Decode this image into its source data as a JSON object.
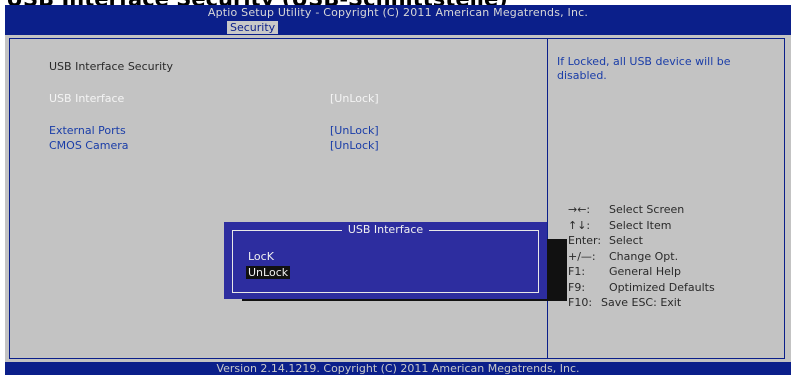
{
  "document": {
    "heading": "USB Interface Security (USB-Schnittstelle)"
  },
  "header": {
    "title": "Aptio Setup Utility - Copyright (C) 2011 American Megatrends, Inc.",
    "active_tab": "Security"
  },
  "section_title": "USB Interface Security",
  "settings": [
    {
      "label": "USB Interface",
      "value": "[UnLock]"
    },
    {
      "label": "External Ports",
      "value": "[UnLock]"
    },
    {
      "label": "CMOS Camera",
      "value": "[UnLock]"
    }
  ],
  "help": "If Locked, all USB device will be disabled.",
  "keys": [
    {
      "key": "→←:",
      "desc": "Select Screen"
    },
    {
      "key": "↑↓:",
      "desc": "Select Item"
    },
    {
      "key": "Enter:",
      "desc": "Select"
    },
    {
      "key": "+/—:",
      "desc": "Change Opt."
    },
    {
      "key": "F1:",
      "desc": "General Help"
    },
    {
      "key": "F9:",
      "desc": "Optimized Defaults"
    },
    {
      "key": "F10:",
      "desc": "Save   ESC: Exit"
    }
  ],
  "popup": {
    "title": "USB Interface",
    "options": [
      "LocK",
      "UnLock"
    ],
    "selected": "UnLock"
  },
  "footer": {
    "version": "Version 2.14.1219. Copyright (C) 2011 American Megatrends, Inc."
  },
  "colors": {
    "bios_blue": "#0b1f8a",
    "panel_gray": "#c3c3c3",
    "popup_blue": "#2d2d9f",
    "highlight_text": "#f4f4f4",
    "link_blue": "#1a3da8"
  }
}
